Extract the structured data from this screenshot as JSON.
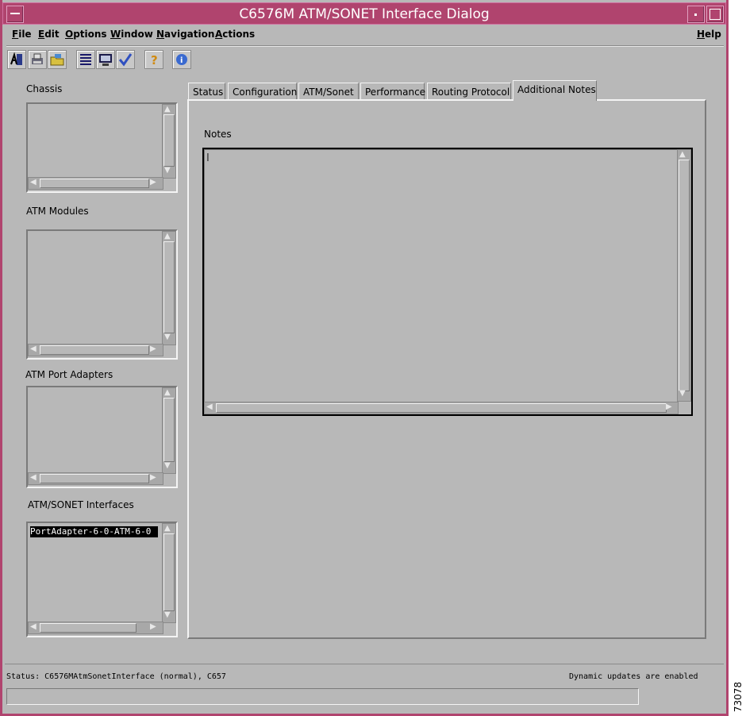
{
  "window": {
    "title": "C6576M ATM/SONET Interface Dialog"
  },
  "menubar": {
    "file": "File",
    "edit": "Edit",
    "options": "Options",
    "window": "Window",
    "navigation": "Navigation",
    "actions": "Actions",
    "help": "Help"
  },
  "toolbar": {
    "icons": [
      "open-dialog-icon",
      "print-icon",
      "folder-icon",
      "list-icon",
      "monitor-icon",
      "checkmark-icon",
      "help-question-icon",
      "info-icon"
    ]
  },
  "sidebar": {
    "chassis_label": "Chassis",
    "atm_modules_label": "ATM Modules",
    "atm_port_adapters_label": "ATM Port Adapters",
    "interfaces_label": "ATM/SONET Interfaces",
    "interfaces_items": [
      "PortAdapter-6-0-ATM-6-0"
    ]
  },
  "tabs": {
    "status": "Status",
    "configuration": "Configuration",
    "atm_sonet": "ATM/Sonet",
    "performance": "Performance",
    "routing_protocol": "Routing Protocol",
    "additional_notes": "Additional Notes",
    "active": "Additional Notes"
  },
  "notes": {
    "label": "Notes",
    "value": ""
  },
  "status": {
    "text": "Status: C6576MAtmSonetInterface (normal), C657",
    "dynamic": "Dynamic updates are enabled"
  },
  "figure_number": "73078",
  "colors": {
    "titlebar": "#b0446e",
    "background": "#b8b8b8"
  }
}
